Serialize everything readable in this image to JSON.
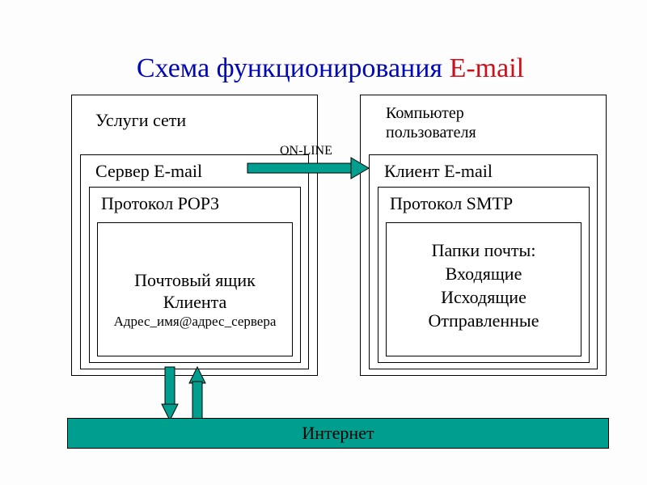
{
  "title": {
    "part1": "Схема функционирования ",
    "part2": "E-mail"
  },
  "online_label": "ON-LINE",
  "left": {
    "outer": "Услуги сети",
    "server": "Сервер E-mail",
    "protocol": "Протокол POP3",
    "mailbox_line1": "Почтовый ящик",
    "mailbox_line2": "Клиента",
    "mailbox_addr": "Адрес_имя@адрес_сервера"
  },
  "right": {
    "outer_line1": "Компьютер",
    "outer_line2": "пользователя",
    "client": "Клиент E-mail",
    "protocol": "Протокол SMTP",
    "folders_title": "Папки почты:",
    "folder_in": "Входящие",
    "folder_out": "Исходящие",
    "folder_sent": "Отправленные"
  },
  "internet": "Интернет",
  "colors": {
    "title_blue": "#0107b5",
    "title_red": "#cd0f1c",
    "arrow_green": "#009e8e",
    "internet_bg": "#009e8e"
  }
}
